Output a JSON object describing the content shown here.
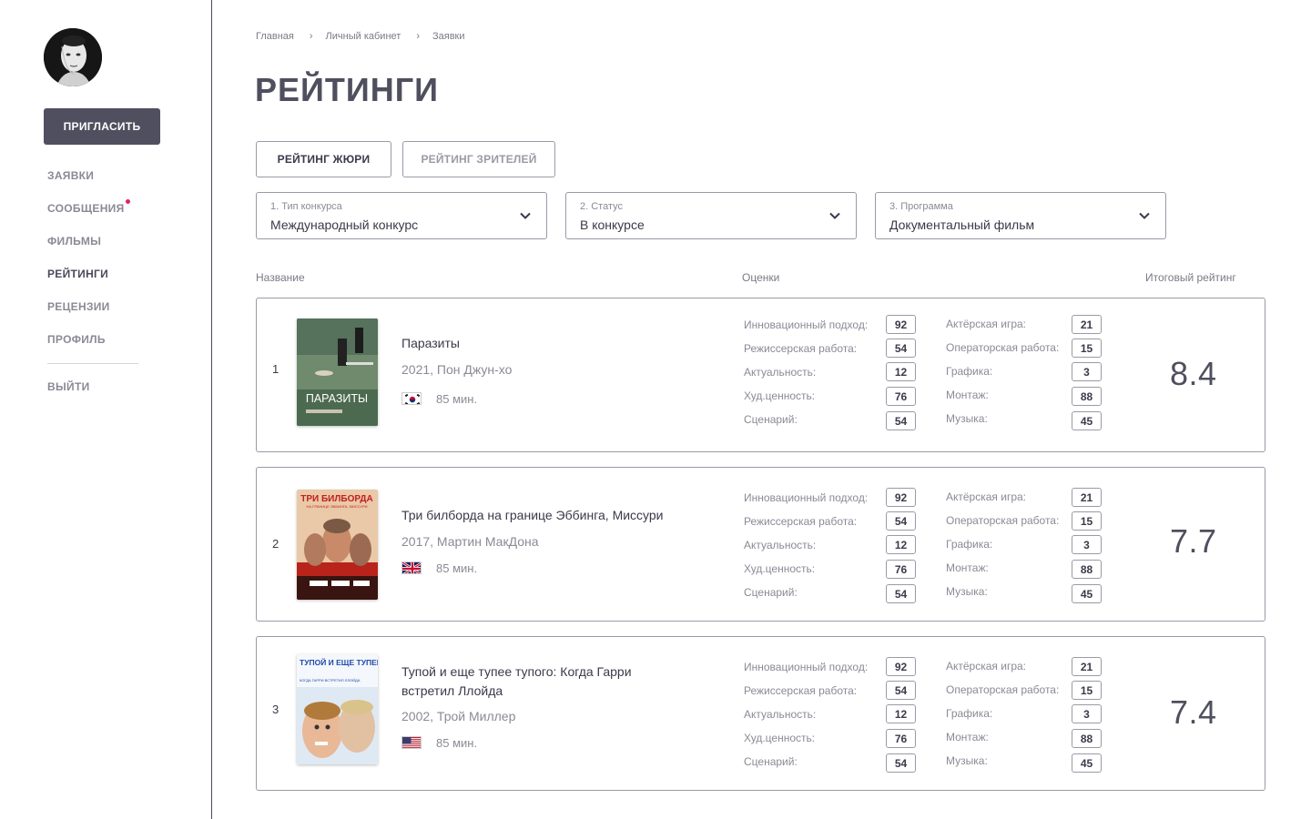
{
  "sidebar": {
    "invite_label": "ПРИГЛАСИТЬ",
    "items": [
      {
        "label": "ЗАЯВКИ",
        "active": false,
        "badge": false
      },
      {
        "label": "СООБЩЕНИЯ",
        "active": false,
        "badge": true
      },
      {
        "label": "ФИЛЬМЫ",
        "active": false,
        "badge": false
      },
      {
        "label": "РЕЙТИНГИ",
        "active": true,
        "badge": false
      },
      {
        "label": "РЕЦЕНЗИИ",
        "active": false,
        "badge": false
      },
      {
        "label": "ПРОФИЛЬ",
        "active": false,
        "badge": false
      }
    ],
    "logout_label": "ВЫЙТИ",
    "badge_color": "#e0245e"
  },
  "breadcrumb": [
    "Главная",
    "Личный кабинет",
    "Заявки"
  ],
  "page_title": "РЕЙТИНГИ",
  "tabs": [
    {
      "label": "РЕЙТИНГ ЖЮРИ",
      "active": true
    },
    {
      "label": "РЕЙТИНГ ЗРИТЕЛЕЙ",
      "active": false
    }
  ],
  "filters": [
    {
      "label": "1. Тип конкурса",
      "value": "Международный конкурс"
    },
    {
      "label": "2. Статус",
      "value": "В конкурсе"
    },
    {
      "label": "3. Программа",
      "value": "Документальный фильм"
    }
  ],
  "columns": {
    "name": "Название",
    "scores": "Оценки",
    "final": "Итоговый рейтинг"
  },
  "score_labels": {
    "left": [
      "Инновационный подход:",
      "Режиссерская работа:",
      "Актуальность:",
      "Худ.ценность:",
      "Сценарий:"
    ],
    "right": [
      "Актёрская игра:",
      "Операторская работа:",
      "Графика:",
      "Монтаж:",
      "Музыка:"
    ]
  },
  "films": [
    {
      "rank": "1",
      "title": "Паразиты",
      "meta": "2021, Пон Джун-хо",
      "flag": "south-korea-flag-icon",
      "duration": "85 мин.",
      "poster_text": "ПАРАЗИТЫ",
      "scores_left": [
        "92",
        "54",
        "12",
        "76",
        "54"
      ],
      "scores_right": [
        "21",
        "15",
        "3",
        "88",
        "45"
      ],
      "final": "8.4"
    },
    {
      "rank": "2",
      "title": "Три билборда на границе Эббинга, Миссури",
      "meta": "2017, Мартин МакДона",
      "flag": "uk-flag-icon",
      "duration": "85 мин.",
      "poster_text": "ТРИ БИЛБОРДА",
      "poster_subtext": "НА ГРАНИЦЕ ЭББИНГА, МИССУРИ",
      "scores_left": [
        "92",
        "54",
        "12",
        "76",
        "54"
      ],
      "scores_right": [
        "21",
        "15",
        "3",
        "88",
        "45"
      ],
      "final": "7.7"
    },
    {
      "rank": "3",
      "title": "Тупой и еще тупее тупого: Когда Гарри встретил Ллойда",
      "meta": "2002, Трой Миллер",
      "flag": "usa-flag-icon",
      "duration": "85 мин.",
      "poster_text": "ТУПОЙ И ЕЩЕ ТУПЕЕ ТУПОГО",
      "poster_subtext": "КОГДА ГАРРИ ВСТРЕТИЛ ЛЛОЙДА",
      "scores_left": [
        "92",
        "54",
        "12",
        "76",
        "54"
      ],
      "scores_right": [
        "21",
        "15",
        "3",
        "88",
        "45"
      ],
      "final": "7.4"
    }
  ]
}
